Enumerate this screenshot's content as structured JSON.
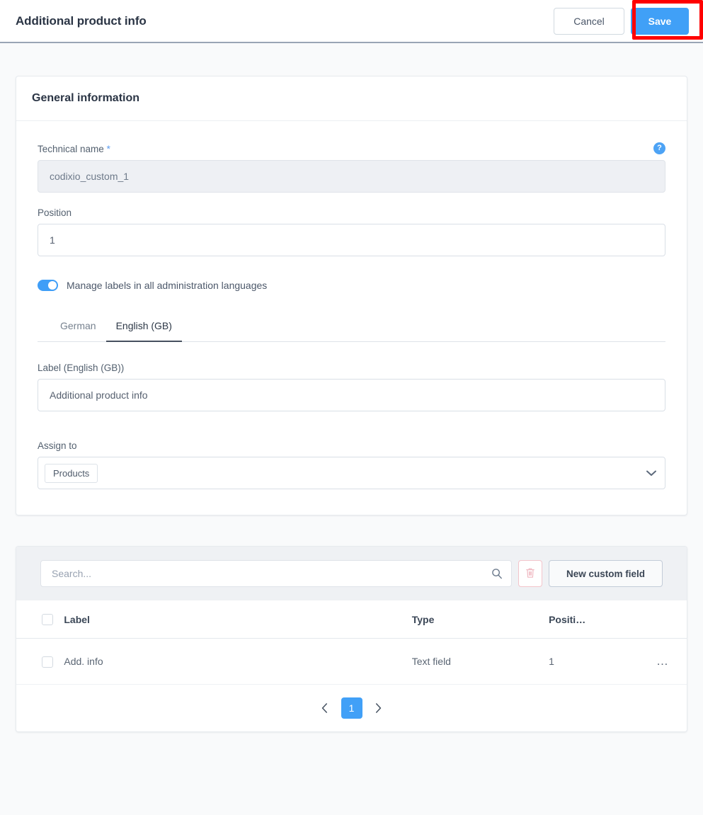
{
  "header": {
    "title": "Additional product info",
    "cancel_label": "Cancel",
    "save_label": "Save",
    "highlight_color": "#ff0000",
    "accent_color": "#40a0f7"
  },
  "general_card": {
    "title": "General information",
    "technical_name": {
      "label": "Technical name",
      "required_marker": "*",
      "value": "codixio_custom_1",
      "help_icon": "question-mark-icon",
      "help_glyph": "?"
    },
    "position": {
      "label": "Position",
      "value": "1"
    },
    "manage_labels_switch": {
      "label": "Manage labels in all administration languages",
      "state": "on"
    },
    "language_tabs": [
      {
        "label": "German",
        "active": false
      },
      {
        "label": "English (GB)",
        "active": true
      }
    ],
    "label_field": {
      "label": "Label (English (GB))",
      "value": "Additional product info"
    },
    "assign_to": {
      "label": "Assign to",
      "chips": [
        "Products"
      ],
      "chevron_icon": "chevron-down-icon"
    }
  },
  "listing_card": {
    "toolbar": {
      "search_placeholder": "Search...",
      "search_value": "",
      "search_icon": "search-icon",
      "delete_icon": "trash-icon",
      "new_field_label": "New custom field"
    },
    "table": {
      "columns": [
        "Label",
        "Type",
        "Positi…"
      ],
      "rows": [
        {
          "label": "Add. info",
          "type": "Text field",
          "position": "1",
          "menu_icon": "ellipsis-icon"
        }
      ]
    },
    "pagination": {
      "prev_icon": "chevron-left-icon",
      "next_icon": "chevron-right-icon",
      "current_page": "1"
    }
  }
}
